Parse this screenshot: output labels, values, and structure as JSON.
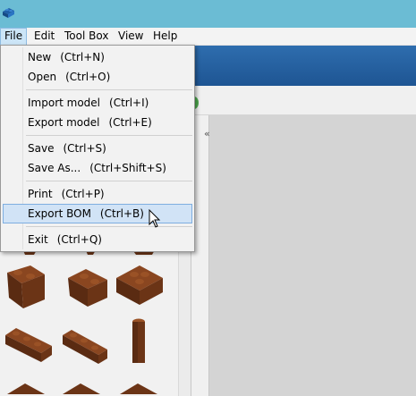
{
  "menubar": {
    "items": [
      "File",
      "Edit",
      "Tool Box",
      "View",
      "Help"
    ]
  },
  "file_menu": {
    "items": [
      {
        "label": "New",
        "shortcut": "(Ctrl+N)"
      },
      {
        "label": "Open",
        "shortcut": "(Ctrl+O)"
      },
      {
        "label": "Import model",
        "shortcut": "(Ctrl+I)"
      },
      {
        "label": "Export model",
        "shortcut": "(Ctrl+E)"
      },
      {
        "label": "Save",
        "shortcut": "(Ctrl+S)"
      },
      {
        "label": "Save As...",
        "shortcut": "(Ctrl+Shift+S)"
      },
      {
        "label": "Print",
        "shortcut": "(Ctrl+P)"
      },
      {
        "label": "Export BOM",
        "shortcut": "(Ctrl+B)"
      },
      {
        "label": "Exit",
        "shortcut": "(Ctrl+Q)"
      }
    ]
  },
  "palette": {
    "panel_collapse_glyph": "«"
  },
  "colors": {
    "titlebar": "#6bbcd4",
    "brick": "#6b3416",
    "hover": "#d1e3f6"
  }
}
